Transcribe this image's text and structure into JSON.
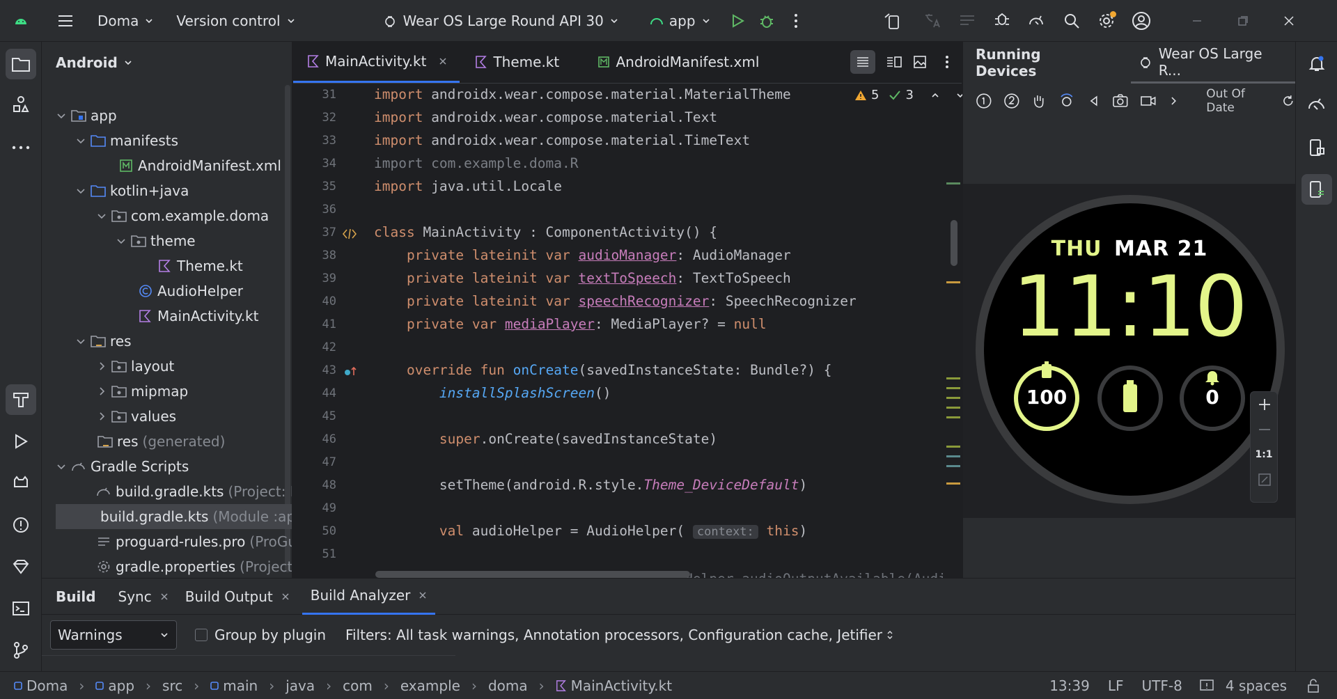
{
  "titlebar": {
    "project": "Doma",
    "vcs": "Version control",
    "device": "Wear OS Large Round API 30",
    "run_config": "app"
  },
  "project_panel": {
    "title": "Android",
    "tree": [
      {
        "label": "app",
        "hint": ""
      },
      {
        "label": "manifests",
        "hint": ""
      },
      {
        "label": "AndroidManifest.xml",
        "hint": ""
      },
      {
        "label": "kotlin+java",
        "hint": ""
      },
      {
        "label": "com.example.doma",
        "hint": ""
      },
      {
        "label": "theme",
        "hint": ""
      },
      {
        "label": "Theme.kt",
        "hint": ""
      },
      {
        "label": "AudioHelper",
        "hint": ""
      },
      {
        "label": "MainActivity.kt",
        "hint": ""
      },
      {
        "label": "res",
        "hint": ""
      },
      {
        "label": "layout",
        "hint": ""
      },
      {
        "label": "mipmap",
        "hint": ""
      },
      {
        "label": "values",
        "hint": ""
      },
      {
        "label": "res",
        "hint": "(generated)"
      },
      {
        "label": "Gradle Scripts",
        "hint": ""
      },
      {
        "label": "build.gradle.kts",
        "hint": "(Project: Do"
      },
      {
        "label": "build.gradle.kts",
        "hint": "(Module :ap"
      },
      {
        "label": "proguard-rules.pro",
        "hint": "(ProGua"
      },
      {
        "label": "gradle.properties",
        "hint": "(Project P"
      }
    ]
  },
  "editor": {
    "tabs": [
      "MainActivity.kt",
      "Theme.kt",
      "AndroidManifest.xml"
    ],
    "warnings": "5",
    "checks": "3",
    "line_numbers": [
      "31",
      "32",
      "33",
      "34",
      "35",
      "36",
      "37",
      "38",
      "39",
      "40",
      "41",
      "42",
      "43",
      "44",
      "45",
      "46",
      "47",
      "48",
      "49",
      "50",
      "51"
    ],
    "inlay_context": "context:"
  },
  "devices": {
    "title": "Running Devices",
    "device_tab": "Wear OS Large R...",
    "status": "Out Of Date",
    "zoom_label": "1:1",
    "watch": {
      "day": "THU",
      "date": "MAR 21",
      "time": "11:10",
      "battery_value": "100",
      "notif_value": "0",
      "battery_progress": 1.0
    }
  },
  "build": {
    "tabs": [
      "Build",
      "Sync",
      "Build Output",
      "Build Analyzer"
    ],
    "filter_select": "Warnings",
    "group_label": "Group by plugin",
    "filters": "Filters: All task warnings, Annotation processors, Configuration cache, Jetifier"
  },
  "status": {
    "crumbs": [
      "Doma",
      "app",
      "src",
      "main",
      "java",
      "com",
      "example",
      "doma",
      "MainActivity.kt"
    ],
    "position": "13:39",
    "line_sep": "LF",
    "encoding": "UTF-8",
    "indent": "4 spaces"
  },
  "colors": {
    "accent": "#3574f0",
    "watch_lime": "#e3f58a",
    "keyword": "#cf8e6d",
    "function": "#56a8f5",
    "property": "#c77dbb"
  }
}
